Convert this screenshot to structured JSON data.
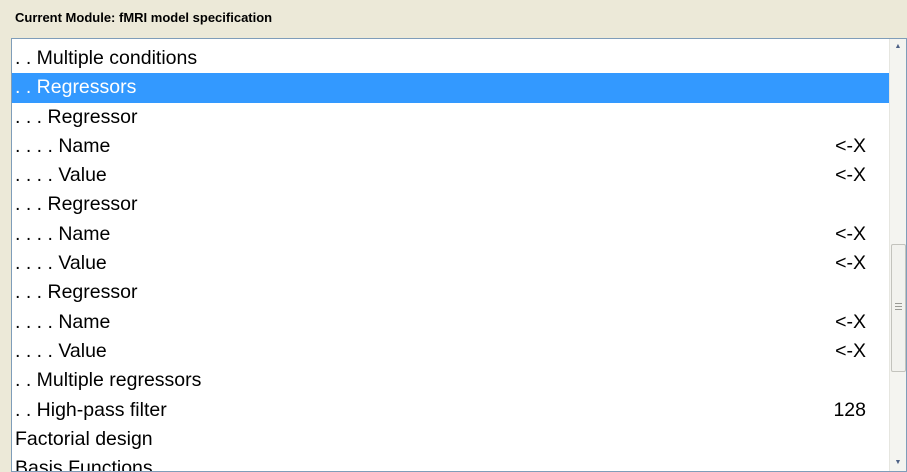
{
  "header": {
    "title": "Current Module: fMRI model specification"
  },
  "list": {
    "rows": [
      {
        "label": ". . Multiple conditions",
        "value": "",
        "selected": false
      },
      {
        "label": ". . Regressors",
        "value": "",
        "selected": true
      },
      {
        "label": ". . . Regressor",
        "value": "",
        "selected": false
      },
      {
        "label": ". . . . Name",
        "value": "<-X",
        "selected": false
      },
      {
        "label": ". . . . Value",
        "value": "<-X",
        "selected": false
      },
      {
        "label": ". . . Regressor",
        "value": "",
        "selected": false
      },
      {
        "label": ". . . . Name",
        "value": "<-X",
        "selected": false
      },
      {
        "label": ". . . . Value",
        "value": "<-X",
        "selected": false
      },
      {
        "label": ". . . Regressor",
        "value": "",
        "selected": false
      },
      {
        "label": ". . . . Name",
        "value": "<-X",
        "selected": false
      },
      {
        "label": ". . . . Value",
        "value": "<-X",
        "selected": false
      },
      {
        "label": ". . Multiple regressors",
        "value": "",
        "selected": false
      },
      {
        "label": ". . High-pass filter",
        "value": "128",
        "selected": false
      },
      {
        "label": "Factorial design",
        "value": "",
        "selected": false
      },
      {
        "label": "Basis Functions",
        "value": "",
        "selected": false
      }
    ]
  },
  "scrollbar": {
    "up_icon": "scroll-up-arrow-icon",
    "down_icon": "scroll-down-arrow-icon"
  },
  "colors": {
    "selection": "#3399ff",
    "panel_bg": "#ece9d8",
    "list_bg": "#ffffff"
  }
}
